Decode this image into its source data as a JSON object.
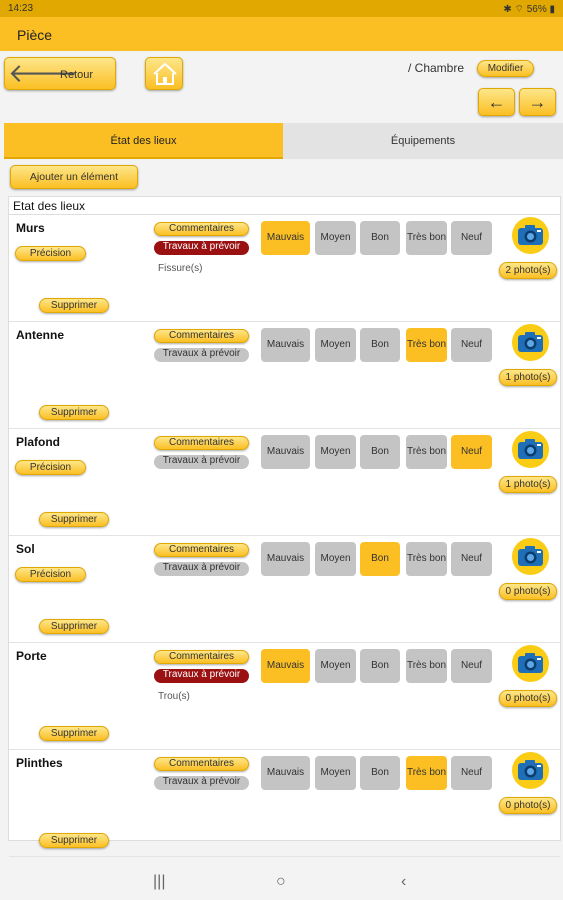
{
  "status": {
    "time": "14:23",
    "indicators": "✱ ⌔ 56% ▮"
  },
  "appbar": {
    "title": "Pièce"
  },
  "toolbar": {
    "back_label": "Retour",
    "back_arrow": "🡐",
    "home_icon": "home-icon",
    "room": "/ Chambre",
    "modify_label": "Modifier",
    "prev": "←",
    "next": "→"
  },
  "tabs": [
    {
      "label": "État des lieux",
      "active": true
    },
    {
      "label": "Équipements",
      "active": false
    }
  ],
  "add_label": "Ajouter un élément",
  "section_title": "Etat des lieux",
  "labels": {
    "comments": "Commentaires",
    "works": "Travaux à prévoir",
    "precision": "Précision",
    "delete": "Supprimer"
  },
  "ratings": [
    "Mauvais",
    "Moyen",
    "Bon",
    "Très bon",
    "Neuf"
  ],
  "items": [
    {
      "name": "Murs",
      "rating": "Mauvais",
      "works": true,
      "note": "Fissure(s)",
      "precision": true,
      "photos": "2 photo(s)"
    },
    {
      "name": "Antenne",
      "rating": "Très bon",
      "works": false,
      "note": "",
      "precision": false,
      "photos": "1 photo(s)"
    },
    {
      "name": "Plafond",
      "rating": "Neuf",
      "works": false,
      "note": "",
      "precision": true,
      "photos": "1 photo(s)"
    },
    {
      "name": "Sol",
      "rating": "Bon",
      "works": false,
      "note": "",
      "precision": true,
      "photos": "0 photo(s)"
    },
    {
      "name": "Porte",
      "rating": "Mauvais",
      "works": true,
      "note": "Trou(s)",
      "precision": false,
      "photos": "0 photo(s)"
    },
    {
      "name": "Plinthes",
      "rating": "Très bon",
      "works": false,
      "note": "",
      "precision": false,
      "photos": "0 photo(s)"
    }
  ],
  "navbar": {
    "recents": "|||",
    "home": "○",
    "back": "‹"
  },
  "colors": {
    "accent": "#fbbf24",
    "works_active": "#9b1111",
    "inactive": "#c4c4c4",
    "camera_blue": "#1e6fb8"
  }
}
